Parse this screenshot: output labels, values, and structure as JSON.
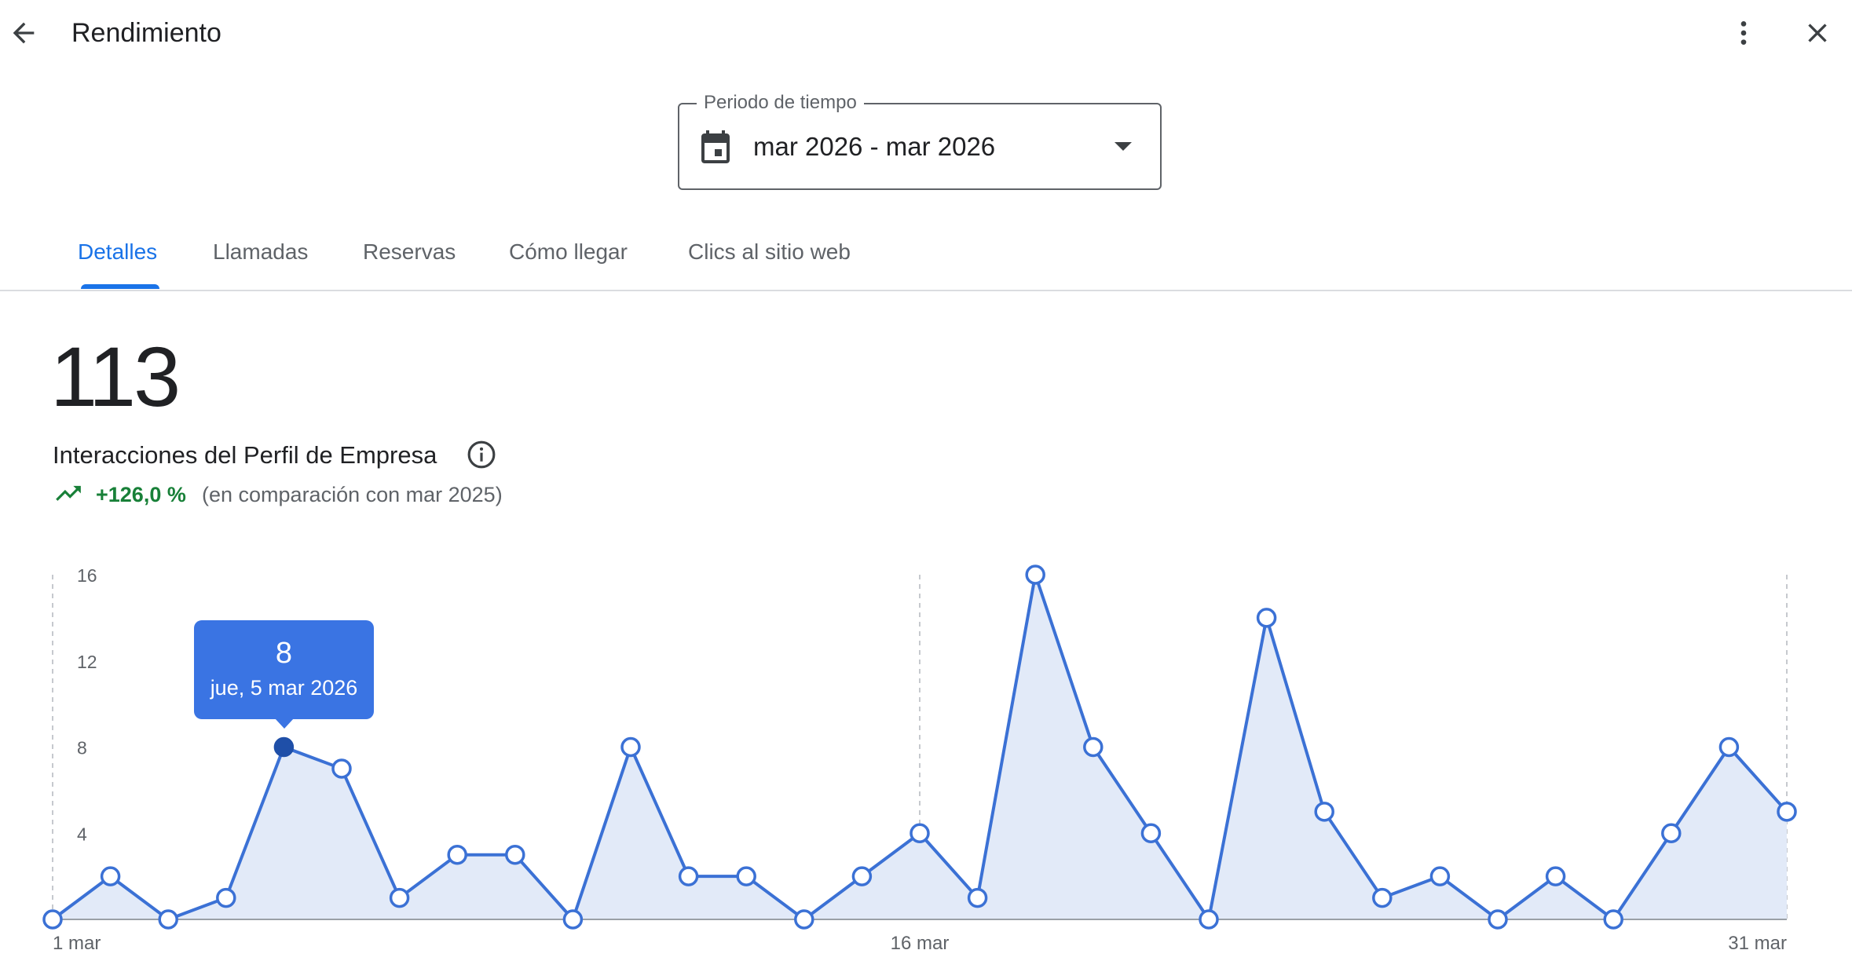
{
  "header": {
    "title": "Rendimiento",
    "back_icon": "arrow-back-icon",
    "more_icon": "more-vert-icon",
    "close_icon": "close-icon"
  },
  "period": {
    "legend": "Periodo de tiempo",
    "value": "mar 2026 - mar 2026",
    "icon": "calendar-icon"
  },
  "tabs": [
    {
      "label": "Detalles",
      "active": true
    },
    {
      "label": "Llamadas",
      "active": false
    },
    {
      "label": "Reservas",
      "active": false
    },
    {
      "label": "Cómo llegar",
      "active": false
    },
    {
      "label": "Clics al sitio web",
      "active": false
    }
  ],
  "summary": {
    "total": "113",
    "label": "Interacciones del Perfil de Empresa",
    "trend_value": "+126,0 %",
    "trend_compare": "(en comparación con mar 2025)",
    "trend_color": "#188038"
  },
  "tooltip": {
    "value": "8",
    "date": "jue, 5 mar 2026"
  },
  "colors": {
    "accent": "#1a73e8",
    "line": "#3b71d5",
    "area": "#e2eaf8",
    "tooltip": "#3a74e3",
    "selected_point": "#1f4fa8"
  },
  "chart_data": {
    "type": "area",
    "x": [
      "1 mar",
      "2 mar",
      "3 mar",
      "4 mar",
      "5 mar",
      "6 mar",
      "7 mar",
      "8 mar",
      "9 mar",
      "10 mar",
      "11 mar",
      "12 mar",
      "13 mar",
      "14 mar",
      "15 mar",
      "16 mar",
      "17 mar",
      "18 mar",
      "19 mar",
      "20 mar",
      "21 mar",
      "22 mar",
      "23 mar",
      "24 mar",
      "25 mar",
      "26 mar",
      "27 mar",
      "28 mar",
      "29 mar",
      "30 mar",
      "31 mar"
    ],
    "values": [
      0,
      2,
      0,
      1,
      8,
      7,
      1,
      3,
      3,
      0,
      8,
      2,
      2,
      0,
      2,
      4,
      1,
      16,
      8,
      4,
      0,
      14,
      5,
      1,
      2,
      0,
      2,
      0,
      4,
      8,
      5
    ],
    "x_tick_labels": [
      "1 mar",
      "16 mar",
      "31 mar"
    ],
    "y_ticks": [
      4,
      8,
      12,
      16
    ],
    "ylim": [
      0,
      16
    ],
    "selected_index": 4,
    "grid": "vertical-dashed"
  }
}
